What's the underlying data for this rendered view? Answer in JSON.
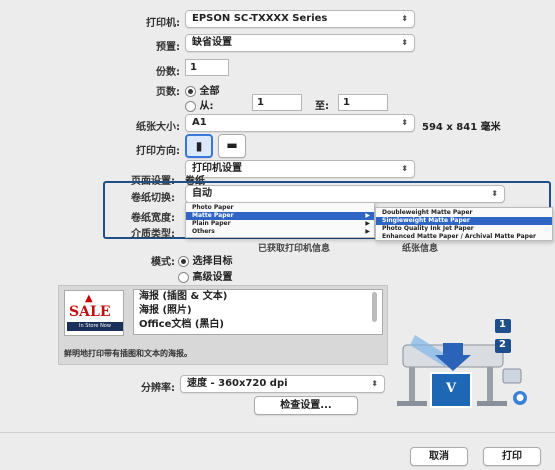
{
  "printer": {
    "label": "打印机:",
    "value": "EPSON SC-TXXXX Series"
  },
  "preset": {
    "label": "预置:",
    "value": "缺省设置"
  },
  "copies": {
    "label": "份数:",
    "value": "1"
  },
  "pages": {
    "label": "页数:",
    "all": "全部",
    "from": "从:",
    "from_value": "1",
    "to": "至:",
    "to_value": "1"
  },
  "paper_size": {
    "label": "纸张大小:",
    "value": "A1",
    "dims": "594 x 841 毫米"
  },
  "orientation": {
    "label": "打印方向:"
  },
  "section_popup": {
    "value": "打印机设置"
  },
  "page_setup": {
    "label": "页面设置:",
    "value": "卷纸"
  },
  "roll_switch": {
    "label": "卷纸切换:",
    "value": "自动"
  },
  "roll_width": {
    "label": "卷纸宽度:"
  },
  "media_type": {
    "label": "介质类型:"
  },
  "obtain_button": {
    "label": "已获取打印机信息"
  },
  "paper_info_button": {
    "label": "纸张信息"
  },
  "media_menu": [
    "Photo Paper",
    "Matte Paper",
    "Plain Paper",
    "Others"
  ],
  "matte_submenu": [
    "Doubleweight Matte Paper",
    "Singleweight Matte Paper",
    "Photo Quality Ink Jet Paper",
    "Enhanced Matte Paper / Archival Matte Paper"
  ],
  "mode": {
    "label": "模式:",
    "option1": "选择目标",
    "option2": "高级设置"
  },
  "targets": [
    "海报 (插图 & 文本)",
    "海报 (照片)",
    "Office文档 (黑白)"
  ],
  "sale_thumb": {
    "sale": "SALE",
    "sub": "In Store Now"
  },
  "description": "鲜明地打印带有插图和文本的海报。",
  "resolution": {
    "label": "分辨率:",
    "value": "速度 - 360x720 dpi"
  },
  "check_button": {
    "label": "检查设置..."
  },
  "printer_badge": {
    "one": "1",
    "two": "2",
    "v": "V"
  },
  "cancel_button": {
    "label": "取消"
  },
  "print_button": {
    "label": "打印"
  },
  "colors": {
    "accent": "#2f66c4",
    "highlight_border": "#1e4f86"
  }
}
